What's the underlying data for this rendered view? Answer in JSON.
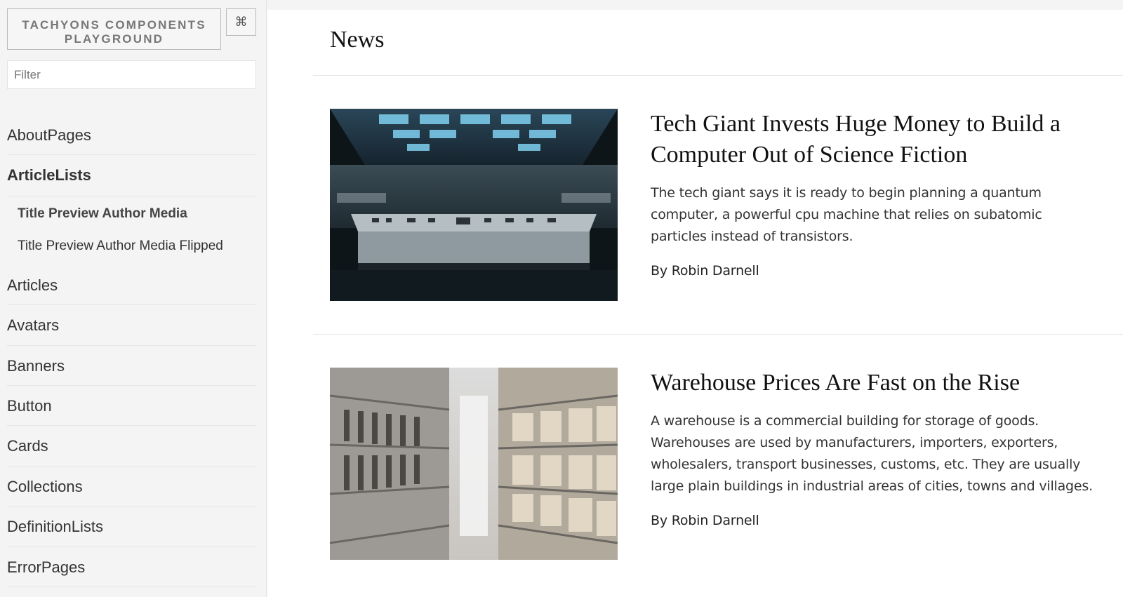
{
  "sidebar": {
    "title_line1": "TACHYONS COMPONENTS",
    "title_line2": "PLAYGROUND",
    "cmd_label": "⌘",
    "filter_placeholder": "Filter",
    "nav": [
      {
        "label": "AboutPages"
      },
      {
        "label": "ArticleLists",
        "active": true,
        "children": [
          {
            "label": "Title Preview Author Media",
            "active": true
          },
          {
            "label": "Title Preview Author Media Flipped"
          }
        ]
      },
      {
        "label": "Articles"
      },
      {
        "label": "Avatars"
      },
      {
        "label": "Banners"
      },
      {
        "label": "Button"
      },
      {
        "label": "Cards"
      },
      {
        "label": "Collections"
      },
      {
        "label": "DefinitionLists"
      },
      {
        "label": "ErrorPages"
      }
    ]
  },
  "main": {
    "heading": "News",
    "articles": [
      {
        "title": "Tech Giant Invests Huge Money to Build a Computer Out of Science Fiction",
        "preview": "The tech giant says it is ready to begin planning a quantum computer, a powerful cpu machine that relies on subatomic particles instead of transistors.",
        "author": "By Robin Darnell",
        "image": "control-room-photo"
      },
      {
        "title": "Warehouse Prices Are Fast on the Rise",
        "preview": "A warehouse is a commercial building for storage of goods. Warehouses are used by manufacturers, importers, exporters, wholesalers, transport businesses, customs, etc. They are usually large plain buildings in industrial areas of cities, towns and villages.",
        "author": "By Robin Darnell",
        "image": "warehouse-aisle-photo"
      }
    ]
  }
}
